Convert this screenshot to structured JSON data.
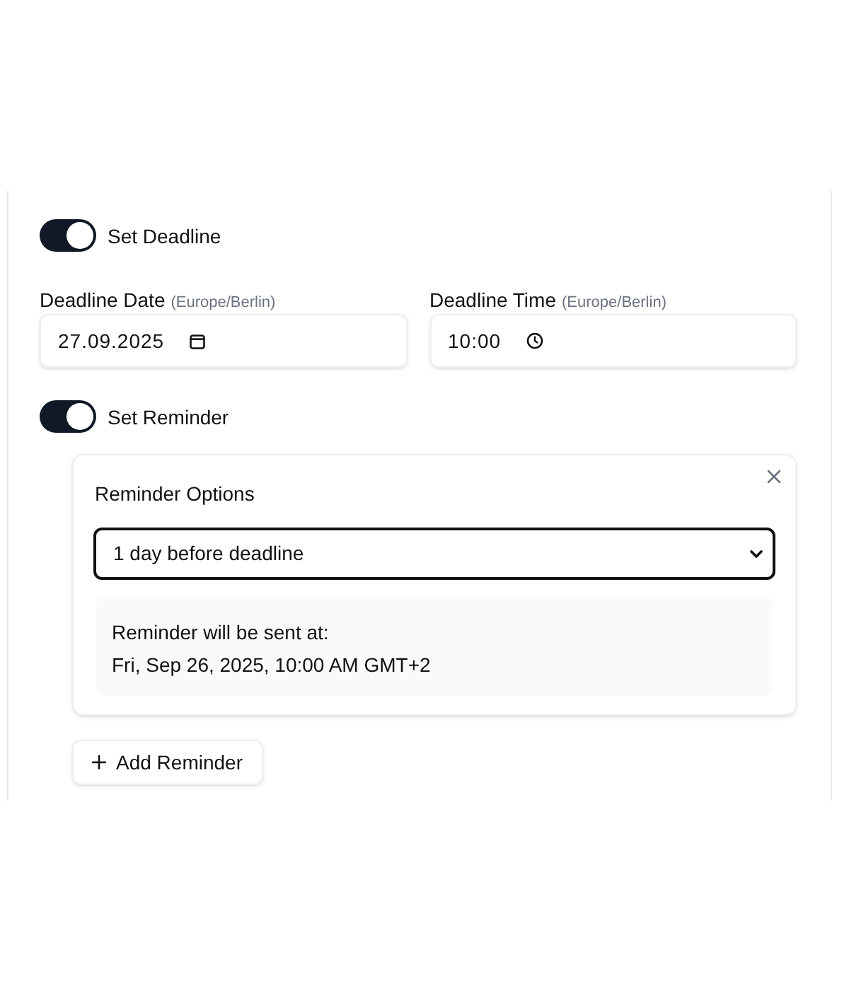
{
  "deadline_toggle": {
    "label": "Set Deadline",
    "on": true
  },
  "deadline_fields": [
    {
      "kind": "date",
      "label": "Deadline Date",
      "timezone": "(Europe/Berlin)",
      "value": "27.09.2025"
    },
    {
      "kind": "time",
      "label": "Deadline Time",
      "timezone": "(Europe/Berlin)",
      "value": "10:00"
    }
  ],
  "reminder_toggle": {
    "label": "Set Reminder",
    "on": true
  },
  "reminders": [
    {
      "title": "Reminder Options",
      "option": "1 day before deadline",
      "preview_label": "Reminder will be sent at:",
      "preview_value": "Fri, Sep 26, 2025, 10:00 AM GMT+2"
    }
  ],
  "add_button": {
    "label": "Add Reminder"
  }
}
